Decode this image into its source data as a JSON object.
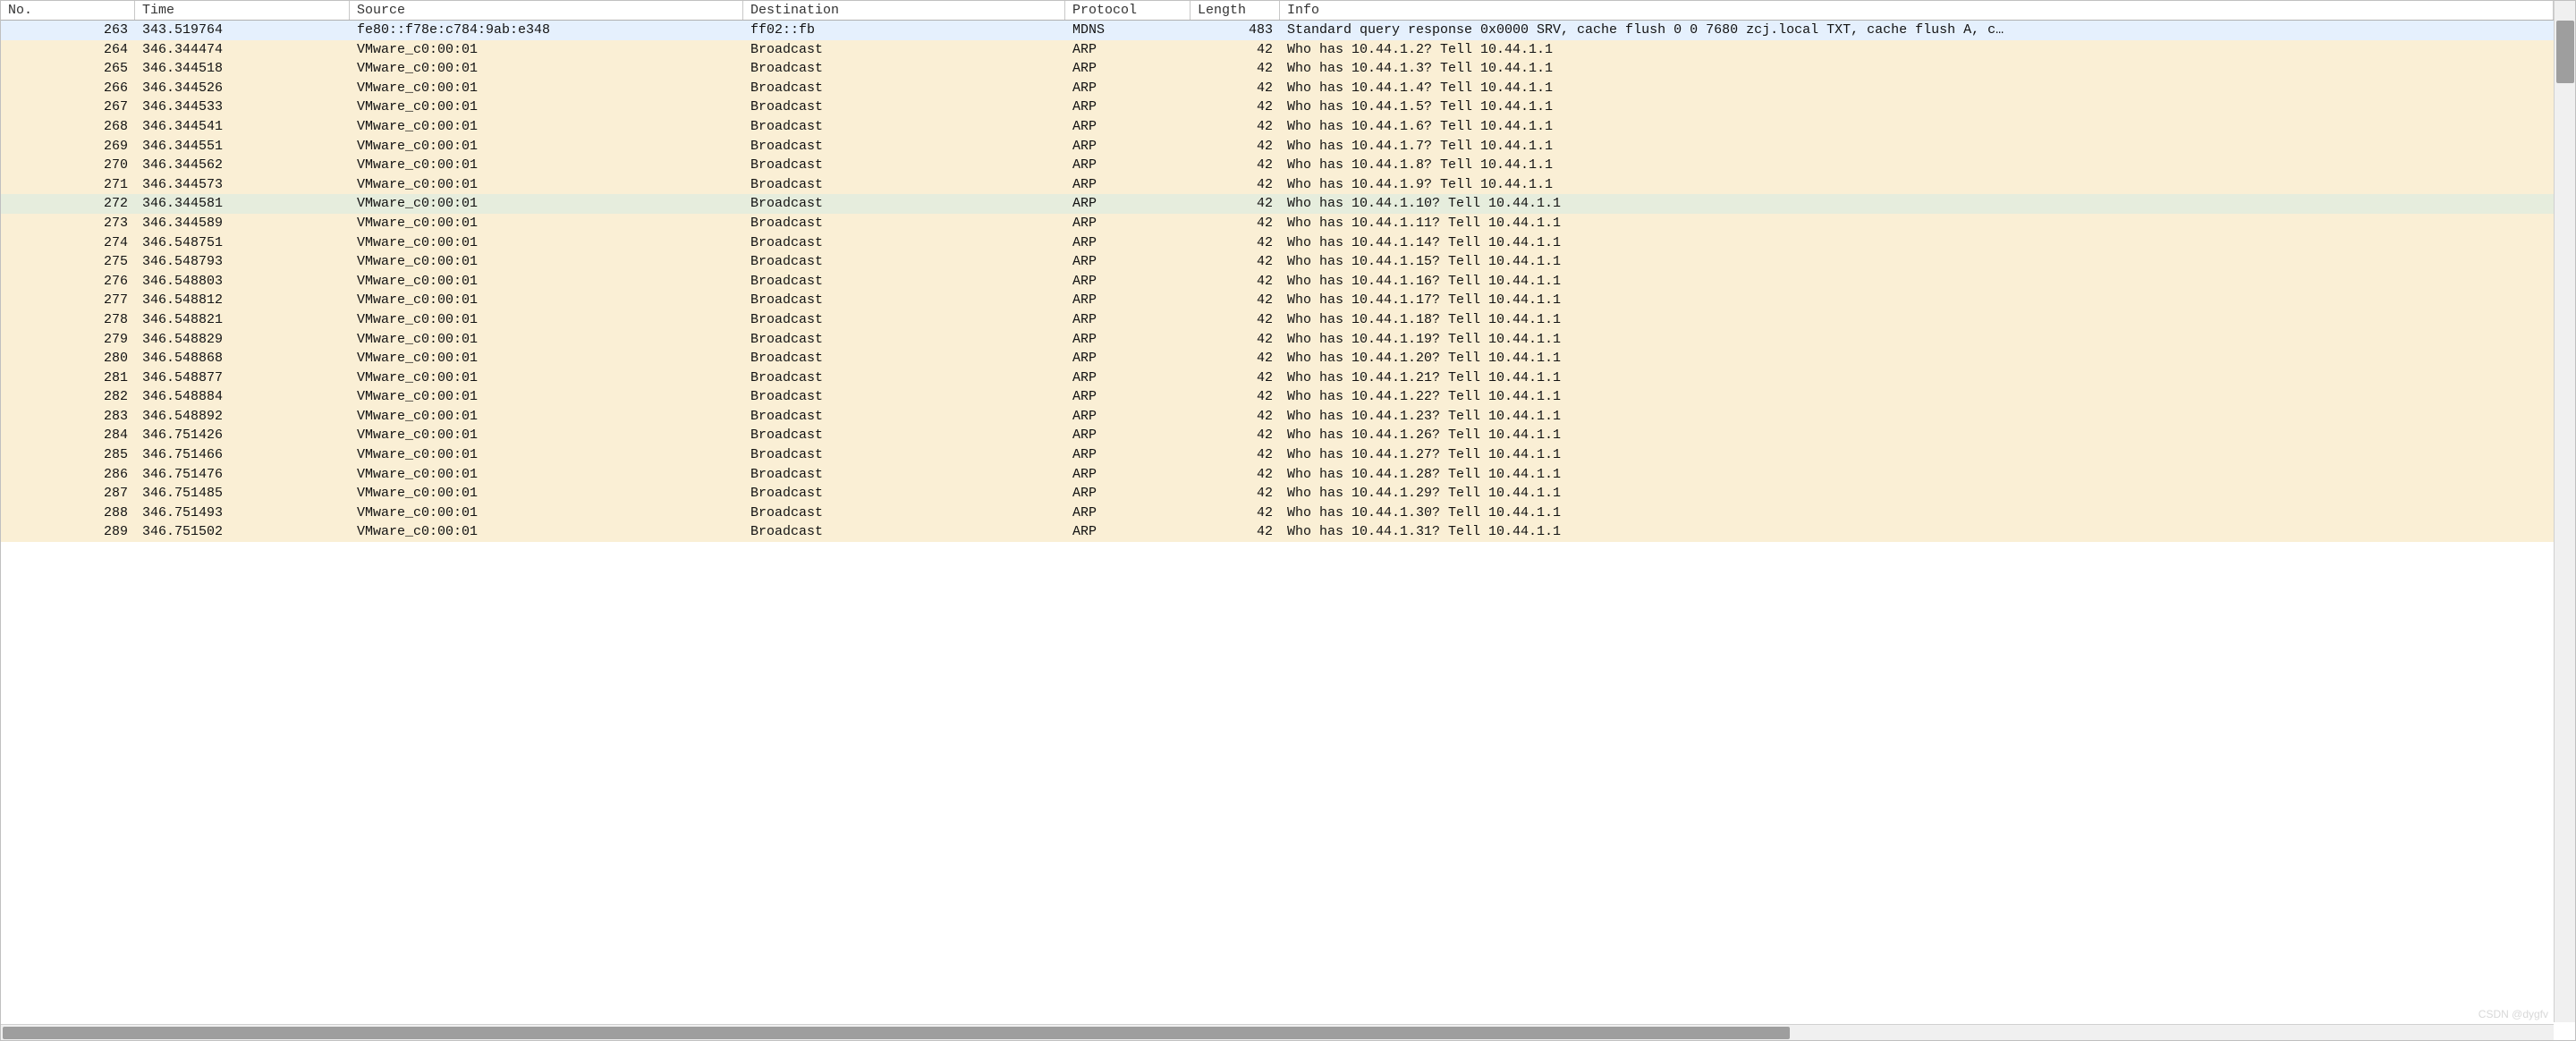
{
  "columns": {
    "no": "No.",
    "time": "Time",
    "source": "Source",
    "destination": "Destination",
    "protocol": "Protocol",
    "length": "Length",
    "info": "Info"
  },
  "selected_index": 0,
  "hover_index": 9,
  "packets": [
    {
      "no": "263",
      "time": "343.519764",
      "source": "fe80::f78e:c784:9ab:e348",
      "destination": "ff02::fb",
      "protocol": "MDNS",
      "length": "483",
      "info": "Standard query response 0x0000 SRV, cache flush 0 0 7680 zcj.local TXT, cache flush A, c…",
      "bg": "blue"
    },
    {
      "no": "264",
      "time": "346.344474",
      "source": "VMware_c0:00:01",
      "destination": "Broadcast",
      "protocol": "ARP",
      "length": "42",
      "info": "Who has 10.44.1.2? Tell 10.44.1.1",
      "bg": "beige"
    },
    {
      "no": "265",
      "time": "346.344518",
      "source": "VMware_c0:00:01",
      "destination": "Broadcast",
      "protocol": "ARP",
      "length": "42",
      "info": "Who has 10.44.1.3? Tell 10.44.1.1",
      "bg": "beige"
    },
    {
      "no": "266",
      "time": "346.344526",
      "source": "VMware_c0:00:01",
      "destination": "Broadcast",
      "protocol": "ARP",
      "length": "42",
      "info": "Who has 10.44.1.4? Tell 10.44.1.1",
      "bg": "beige"
    },
    {
      "no": "267",
      "time": "346.344533",
      "source": "VMware_c0:00:01",
      "destination": "Broadcast",
      "protocol": "ARP",
      "length": "42",
      "info": "Who has 10.44.1.5? Tell 10.44.1.1",
      "bg": "beige"
    },
    {
      "no": "268",
      "time": "346.344541",
      "source": "VMware_c0:00:01",
      "destination": "Broadcast",
      "protocol": "ARP",
      "length": "42",
      "info": "Who has 10.44.1.6? Tell 10.44.1.1",
      "bg": "beige"
    },
    {
      "no": "269",
      "time": "346.344551",
      "source": "VMware_c0:00:01",
      "destination": "Broadcast",
      "protocol": "ARP",
      "length": "42",
      "info": "Who has 10.44.1.7? Tell 10.44.1.1",
      "bg": "beige"
    },
    {
      "no": "270",
      "time": "346.344562",
      "source": "VMware_c0:00:01",
      "destination": "Broadcast",
      "protocol": "ARP",
      "length": "42",
      "info": "Who has 10.44.1.8? Tell 10.44.1.1",
      "bg": "beige"
    },
    {
      "no": "271",
      "time": "346.344573",
      "source": "VMware_c0:00:01",
      "destination": "Broadcast",
      "protocol": "ARP",
      "length": "42",
      "info": "Who has 10.44.1.9? Tell 10.44.1.1",
      "bg": "beige"
    },
    {
      "no": "272",
      "time": "346.344581",
      "source": "VMware_c0:00:01",
      "destination": "Broadcast",
      "protocol": "ARP",
      "length": "42",
      "info": "Who has 10.44.1.10? Tell 10.44.1.1",
      "bg": "hover"
    },
    {
      "no": "273",
      "time": "346.344589",
      "source": "VMware_c0:00:01",
      "destination": "Broadcast",
      "protocol": "ARP",
      "length": "42",
      "info": "Who has 10.44.1.11? Tell 10.44.1.1",
      "bg": "beige"
    },
    {
      "no": "274",
      "time": "346.548751",
      "source": "VMware_c0:00:01",
      "destination": "Broadcast",
      "protocol": "ARP",
      "length": "42",
      "info": "Who has 10.44.1.14? Tell 10.44.1.1",
      "bg": "beige"
    },
    {
      "no": "275",
      "time": "346.548793",
      "source": "VMware_c0:00:01",
      "destination": "Broadcast",
      "protocol": "ARP",
      "length": "42",
      "info": "Who has 10.44.1.15? Tell 10.44.1.1",
      "bg": "beige"
    },
    {
      "no": "276",
      "time": "346.548803",
      "source": "VMware_c0:00:01",
      "destination": "Broadcast",
      "protocol": "ARP",
      "length": "42",
      "info": "Who has 10.44.1.16? Tell 10.44.1.1",
      "bg": "beige"
    },
    {
      "no": "277",
      "time": "346.548812",
      "source": "VMware_c0:00:01",
      "destination": "Broadcast",
      "protocol": "ARP",
      "length": "42",
      "info": "Who has 10.44.1.17? Tell 10.44.1.1",
      "bg": "beige"
    },
    {
      "no": "278",
      "time": "346.548821",
      "source": "VMware_c0:00:01",
      "destination": "Broadcast",
      "protocol": "ARP",
      "length": "42",
      "info": "Who has 10.44.1.18? Tell 10.44.1.1",
      "bg": "beige"
    },
    {
      "no": "279",
      "time": "346.548829",
      "source": "VMware_c0:00:01",
      "destination": "Broadcast",
      "protocol": "ARP",
      "length": "42",
      "info": "Who has 10.44.1.19? Tell 10.44.1.1",
      "bg": "beige"
    },
    {
      "no": "280",
      "time": "346.548868",
      "source": "VMware_c0:00:01",
      "destination": "Broadcast",
      "protocol": "ARP",
      "length": "42",
      "info": "Who has 10.44.1.20? Tell 10.44.1.1",
      "bg": "beige"
    },
    {
      "no": "281",
      "time": "346.548877",
      "source": "VMware_c0:00:01",
      "destination": "Broadcast",
      "protocol": "ARP",
      "length": "42",
      "info": "Who has 10.44.1.21? Tell 10.44.1.1",
      "bg": "beige"
    },
    {
      "no": "282",
      "time": "346.548884",
      "source": "VMware_c0:00:01",
      "destination": "Broadcast",
      "protocol": "ARP",
      "length": "42",
      "info": "Who has 10.44.1.22? Tell 10.44.1.1",
      "bg": "beige"
    },
    {
      "no": "283",
      "time": "346.548892",
      "source": "VMware_c0:00:01",
      "destination": "Broadcast",
      "protocol": "ARP",
      "length": "42",
      "info": "Who has 10.44.1.23? Tell 10.44.1.1",
      "bg": "beige"
    },
    {
      "no": "284",
      "time": "346.751426",
      "source": "VMware_c0:00:01",
      "destination": "Broadcast",
      "protocol": "ARP",
      "length": "42",
      "info": "Who has 10.44.1.26? Tell 10.44.1.1",
      "bg": "beige"
    },
    {
      "no": "285",
      "time": "346.751466",
      "source": "VMware_c0:00:01",
      "destination": "Broadcast",
      "protocol": "ARP",
      "length": "42",
      "info": "Who has 10.44.1.27? Tell 10.44.1.1",
      "bg": "beige"
    },
    {
      "no": "286",
      "time": "346.751476",
      "source": "VMware_c0:00:01",
      "destination": "Broadcast",
      "protocol": "ARP",
      "length": "42",
      "info": "Who has 10.44.1.28? Tell 10.44.1.1",
      "bg": "beige"
    },
    {
      "no": "287",
      "time": "346.751485",
      "source": "VMware_c0:00:01",
      "destination": "Broadcast",
      "protocol": "ARP",
      "length": "42",
      "info": "Who has 10.44.1.29? Tell 10.44.1.1",
      "bg": "beige"
    },
    {
      "no": "288",
      "time": "346.751493",
      "source": "VMware_c0:00:01",
      "destination": "Broadcast",
      "protocol": "ARP",
      "length": "42",
      "info": "Who has 10.44.1.30? Tell 10.44.1.1",
      "bg": "beige"
    },
    {
      "no": "289",
      "time": "346.751502",
      "source": "VMware_c0:00:01",
      "destination": "Broadcast",
      "protocol": "ARP",
      "length": "42",
      "info": "Who has 10.44.1.31? Tell 10.44.1.1",
      "bg": "beige"
    }
  ],
  "watermark": "CSDN @dygfv"
}
